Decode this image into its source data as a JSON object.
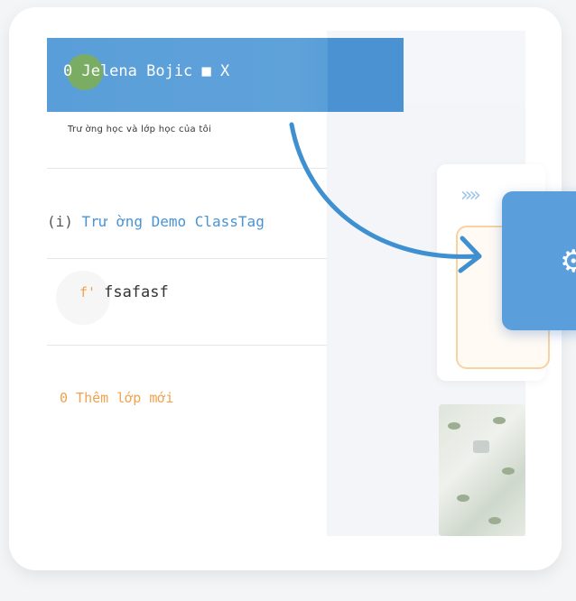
{
  "header": {
    "user_line": "0 Jelena Bojic ■ X"
  },
  "menu": {
    "subtitle": "Trư ờng học và lớp học của tôi",
    "school_prefix": "(i) ",
    "school_name": "Trư ờng Demo ClassTag",
    "class_prefix": "f' ",
    "class_name": "fsafasf",
    "add_class": "0 Thêm lớp mới"
  },
  "background": {
    "chevrons": "»»",
    "chevron_small": "»"
  },
  "icons": {
    "settings": "gear-icon",
    "camera": "camera-icon"
  },
  "colors": {
    "header_blue": "#5a9ed9",
    "accent_blue": "#4a93d4",
    "accent_orange": "#f0a24e",
    "avatar_green": "#7dae55"
  }
}
